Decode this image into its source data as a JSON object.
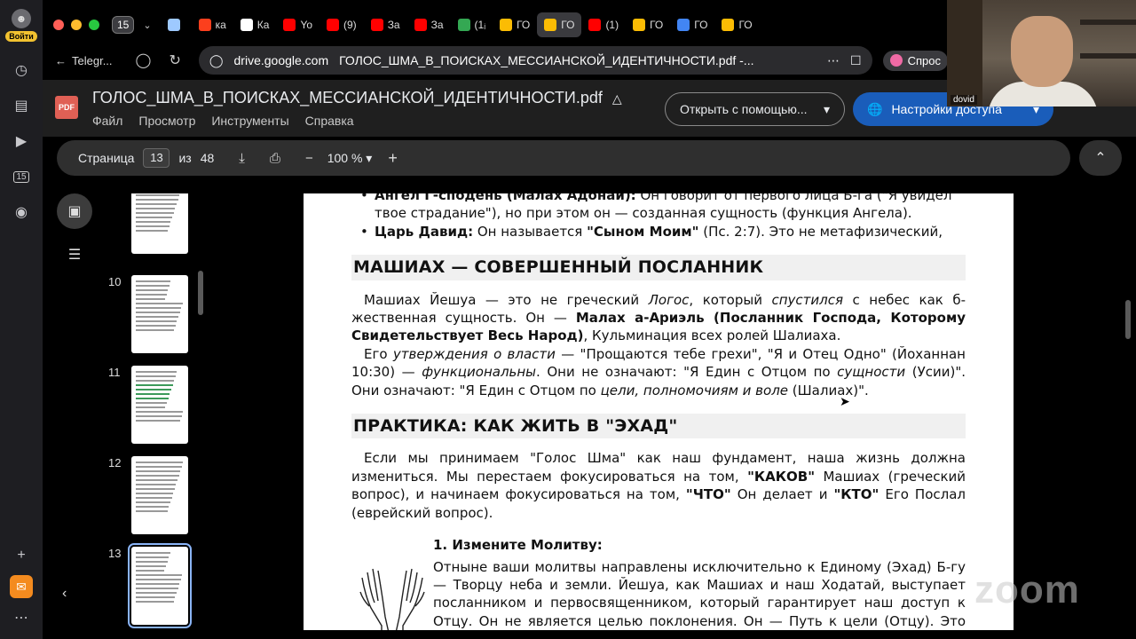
{
  "os_dock": {
    "login_label": "Войти",
    "calendar_badge": "15"
  },
  "browser": {
    "tab_count": "15",
    "tabs": [
      {
        "label": "",
        "color": "#9ec9ff"
      },
      {
        "label": "ка",
        "color": "#fc3f1d"
      },
      {
        "label": "Ка",
        "color": "#ffffff"
      },
      {
        "label": "Yo",
        "color": "#ff0000"
      },
      {
        "label": "(9)",
        "color": "#ff0000"
      },
      {
        "label": "За",
        "color": "#ff0000"
      },
      {
        "label": "За",
        "color": "#ff0000"
      },
      {
        "label": "(1ᵢ",
        "color": "#34a853"
      },
      {
        "label": "ГО",
        "color": "#fbbc04"
      },
      {
        "label": "ГО",
        "color": "#fbbc04",
        "active": true
      },
      {
        "label": "(1)",
        "color": "#ff0000"
      },
      {
        "label": "ГО",
        "color": "#fbbc04"
      },
      {
        "label": "ГО",
        "color": "#4285f4"
      },
      {
        "label": "ГО",
        "color": "#fbbc04"
      }
    ],
    "back_label": "Telegr...",
    "url_host": "drive.google.com",
    "url_title": "ГОЛОС_ШМА_В_ПОИСКАХ_МЕССИАНСКОЙ_ИДЕНТИЧНОСТИ.pdf -...",
    "ask_label": "Спрос"
  },
  "viewer": {
    "file_badge": "PDF",
    "file_title": "ГОЛОС_ШМА_В_ПОИСКАХ_МЕССИАНСКОЙ_ИДЕНТИЧНОСТИ.pdf",
    "menu": [
      "Файл",
      "Просмотр",
      "Инструменты",
      "Справка"
    ],
    "open_with": "Открыть с помощью...",
    "access": "Настройки доступа"
  },
  "toolbar": {
    "page_label": "Страница",
    "page_value": "13",
    "of_label": "из",
    "page_total": "48",
    "zoom": "100 %"
  },
  "thumbnails": [
    {
      "num": "",
      "selected": false
    },
    {
      "num": "10",
      "selected": false
    },
    {
      "num": "11",
      "selected": false
    },
    {
      "num": "12",
      "selected": false
    },
    {
      "num": "13",
      "selected": true
    }
  ],
  "document": {
    "top_bullet_1_bold": "Ангел Г-сподень (Малах Адонай):",
    "top_bullet_1_text": " Он говорит от первого лица Б-га (\"Я увидел твое страдание\"), но при этом он — созданная сущность (функция Ангела).",
    "top_bullet_2_bold": "Царь Давид:",
    "top_bullet_2_pre": " Он называется ",
    "top_bullet_2_bold2": "\"Сыном Моим\"",
    "top_bullet_2_post": " (Пс. 2:7). Это не метафизический,",
    "section1_title": "МАШИАХ — СОВЕРШЕННЫЙ ПОСЛАННИК",
    "s1_p1_a": "Машиах Йешуа — это не греческий ",
    "s1_p1_logos": "Логос",
    "s1_p1_b": ", который ",
    "s1_p1_desc": "спустился",
    "s1_p1_c": " с небес как б-жественная сущность. Он — ",
    "s1_p1_bold": "Малах а-Ариэль (Посланник Господа, Которому Свидетельствует Весь Народ)",
    "s1_p1_d": ", Кульминация всех ролей Шалиаха.",
    "s1_p2_a": "Его ",
    "s1_p2_it1": "утверждения о власти",
    "s1_p2_b": " — \"Прощаются тебе грехи\", \"Я и Отец Одно\" (Йоханнан 10:30) — ",
    "s1_p2_it2": "функциональны",
    "s1_p2_c": ". Они не означают: \"Я Един с Отцом по ",
    "s1_p2_it3": "сущности",
    "s1_p2_d": " (Усии)\". Они означают: \"Я Един с Отцом по ",
    "s1_p2_it4": "цели, полномочиям и воле",
    "s1_p2_e": " (Шалиах)\".",
    "section2_title": "ПРАКТИКА: КАК ЖИТЬ В \"ЭХАД\"",
    "s2_p_a": "Если мы принимаем \"Голос Шма\" как наш фундамент, наша жизнь должна измениться. Мы перестаем фокусироваться на том, ",
    "s2_p_b1": "\"КАКОВ\"",
    "s2_p_c": " Машиах (греческий вопрос), и начинаем фокусироваться на том, ",
    "s2_p_b2": "\"ЧТО\"",
    "s2_p_d": " Он делает и ",
    "s2_p_b3": "\"КТО\"",
    "s2_p_e": " Его Послал (еврейский вопрос).",
    "prayer_title": "1. Измените Молитву:",
    "prayer_text": "Отныне ваши молитвы направлены исключительно к Единому (Эхад) Б-гу — Творцу неба и земли. Йешуа, как Машиах и наш Ходатай, выступает посланником и первосвященником, который гарантирует наш доступ к Отцу. Он не является целью поклонения. Он — Путь к цели (Отцу). Это устраняет путаницу и возвращает нас к чистому библейскому Монотеизму."
  },
  "webcam": {
    "name": "dovid"
  },
  "watermark": "zoom",
  "colors": {
    "accent": "#1a5dba",
    "pdf_badge": "#e06055",
    "selection": "#8ab4f8"
  }
}
